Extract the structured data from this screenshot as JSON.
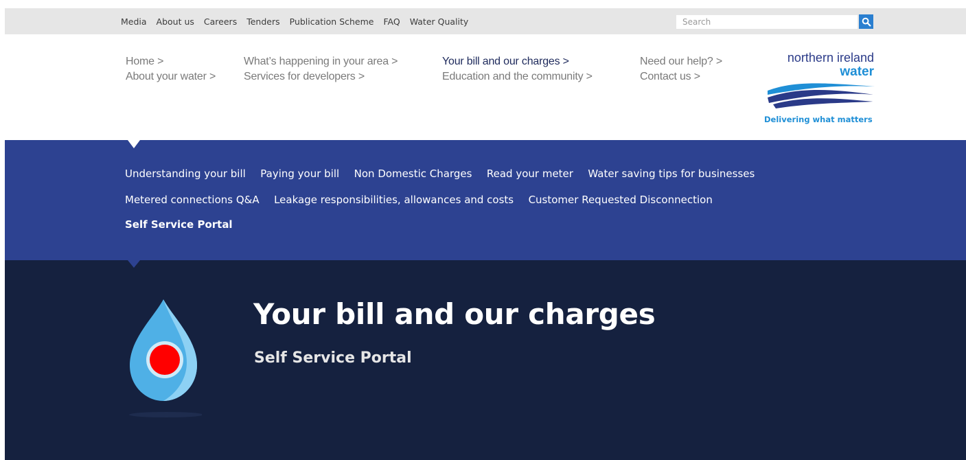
{
  "utility_nav": {
    "links": [
      "Media",
      "About us",
      "Careers",
      "Tenders",
      "Publication Scheme",
      "FAQ",
      "Water Quality"
    ],
    "search_placeholder": "Search"
  },
  "main_nav": {
    "columns": [
      [
        "Home >",
        "About your water >"
      ],
      [
        "What’s happening in your area >",
        "Services for developers >"
      ],
      [
        "Your bill and our charges >",
        "Education and the community >"
      ],
      [
        "Need our help? >",
        "Contact us >"
      ]
    ],
    "active": "Your bill and our charges >"
  },
  "logo": {
    "line1": "northern ireland",
    "line2": "water",
    "tagline": "Delivering what matters"
  },
  "sub_nav": {
    "row1": [
      "Understanding your bill",
      "Paying your bill",
      "Non Domestic Charges",
      "Read your meter",
      "Water saving tips for businesses"
    ],
    "row2": [
      "Metered connections Q&A",
      "Leakage responsibilities, allowances and costs",
      "Customer Requested Disconnection"
    ],
    "row3": [
      "Self Service Portal"
    ],
    "current": "Self Service Portal"
  },
  "hero": {
    "title": "Your bill and our charges",
    "subtitle": "Self Service Portal"
  },
  "colors": {
    "util_bg": "#e6e6e6",
    "subnav_bg": "#2d4291",
    "hero_bg": "#15213f",
    "accent_blue": "#1f8fd6",
    "drop_light": "#5ab4e6",
    "drop_red": "#ff0000"
  },
  "icons": {
    "search": "search-icon",
    "hero": "water-drop-icon"
  }
}
